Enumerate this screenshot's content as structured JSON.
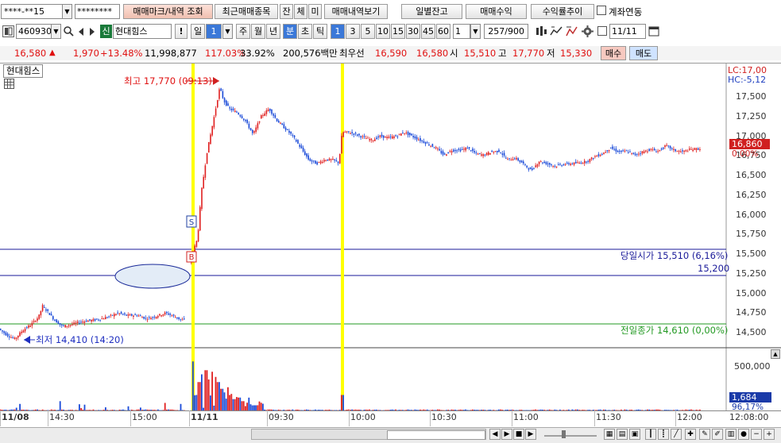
{
  "toolbar1": {
    "account": "****-**15",
    "password": "********",
    "trade_mark_button": "매매마크/내역 조회",
    "recent_trades_button": "최근매매종목",
    "tab_jan": "잔",
    "tab_che": "체",
    "tab_mi": "미",
    "trade_history_button": "매매내역보기",
    "daily_balance_button": "일별잔고",
    "trade_profit_button": "매매수익",
    "return_trend_button": "수익률추이",
    "account_link_label": "계좌연동"
  },
  "toolbar2": {
    "code": "460930",
    "credit_badge": "신",
    "stock_name": "현대힘스",
    "alert_label": "!",
    "period_day": "일",
    "period_value": "1",
    "period_week": "주",
    "period_month": "월",
    "period_year": "년",
    "period_minute": "분",
    "period_second": "초",
    "period_tick": "틱",
    "intervals": [
      "1",
      "3",
      "5",
      "10",
      "15",
      "30",
      "45",
      "60"
    ],
    "interval_input": "1",
    "count_value": "257",
    "count_total": "/900",
    "date_value": "11/11"
  },
  "quote": {
    "price": "16,580",
    "change": "1,970",
    "change_rate": "+13.48%",
    "volume": "11,998,877",
    "volume_ratio": "117.03%",
    "turnover": "33.92%",
    "amount": "200,576백만",
    "priority_label": "최우선",
    "ask": "16,590",
    "bid": "16,580",
    "open_label": "시",
    "open": "15,510",
    "high_label": "고",
    "high": "17,770",
    "low_label": "저",
    "low": "15,330",
    "buy_button": "매수",
    "sell_button": "매도"
  },
  "chart_panel": {
    "legend_name": "현대힘스",
    "lc_label": "LC:17,00",
    "hc_label": "HC:-5,12",
    "current_price": "16,860",
    "current_rate": "0.00%",
    "high_annotation": "최고 17,770 (09:13)",
    "low_annotation": "최저 14,410 (14:20)",
    "open_line_label": "당일시가 15,510 (6,16%)",
    "level_line_label": "15,200",
    "prev_close_label": "전일종가 14,610 (0,00%)",
    "sell_marker": "S",
    "buy_marker": "B",
    "volume_value": "1,684",
    "volume_ratio": "96,17%",
    "volume_axis": "500,000",
    "corner_time": "12:08:00"
  },
  "chart_data": {
    "type": "candlestick",
    "timeframe": "1분",
    "y_ticks": [
      "17,500",
      "17,250",
      "17,000",
      "16,750",
      "16,500",
      "16,250",
      "16,000",
      "15,750",
      "15,500",
      "15,250",
      "15,000",
      "14,750",
      "14,500"
    ],
    "ylim": [
      14400,
      17800
    ],
    "x_ticks": [
      "11/08",
      "14:30",
      "15:00",
      "11/11",
      "09:30",
      "10:00",
      "10:30",
      "11:00",
      "11:30",
      "12:00"
    ],
    "keypoints_day1": [
      [
        0,
        14550
      ],
      [
        10,
        14470
      ],
      [
        20,
        14420
      ],
      [
        30,
        14530
      ],
      [
        40,
        14600
      ],
      [
        50,
        14700
      ],
      [
        55,
        14840
      ],
      [
        62,
        14760
      ],
      [
        70,
        14660
      ],
      [
        80,
        14580
      ],
      [
        90,
        14600
      ],
      [
        100,
        14630
      ],
      [
        110,
        14650
      ],
      [
        120,
        14660
      ],
      [
        130,
        14680
      ],
      [
        140,
        14710
      ],
      [
        150,
        14750
      ],
      [
        160,
        14720
      ],
      [
        175,
        14720
      ],
      [
        185,
        14680
      ],
      [
        195,
        14700
      ],
      [
        210,
        14750
      ],
      [
        220,
        14710
      ],
      [
        230,
        14660
      ]
    ],
    "keypoints_day2": [
      [
        240,
        15400
      ],
      [
        245,
        15550
      ],
      [
        250,
        15700
      ],
      [
        255,
        16300
      ],
      [
        262,
        16800
      ],
      [
        270,
        17200
      ],
      [
        278,
        17620
      ],
      [
        283,
        17450
      ],
      [
        290,
        17350
      ],
      [
        300,
        17300
      ],
      [
        310,
        17200
      ],
      [
        320,
        17020
      ],
      [
        330,
        17250
      ],
      [
        340,
        17350
      ],
      [
        350,
        17200
      ],
      [
        360,
        17100
      ],
      [
        370,
        17000
      ],
      [
        380,
        16850
      ],
      [
        390,
        16700
      ],
      [
        400,
        16650
      ],
      [
        410,
        16700
      ],
      [
        420,
        16700
      ],
      [
        428,
        16660
      ],
      [
        432,
        17050
      ],
      [
        440,
        17050
      ],
      [
        450,
        17020
      ],
      [
        460,
        16980
      ],
      [
        470,
        16950
      ],
      [
        480,
        17000
      ],
      [
        490,
        16980
      ],
      [
        500,
        17000
      ],
      [
        510,
        17050
      ],
      [
        520,
        17000
      ],
      [
        530,
        16950
      ],
      [
        540,
        16900
      ],
      [
        550,
        16850
      ],
      [
        560,
        16760
      ],
      [
        570,
        16820
      ],
      [
        580,
        16820
      ],
      [
        590,
        16850
      ],
      [
        600,
        16780
      ],
      [
        610,
        16760
      ],
      [
        620,
        16800
      ],
      [
        630,
        16810
      ],
      [
        640,
        16700
      ],
      [
        650,
        16720
      ],
      [
        660,
        16650
      ],
      [
        670,
        16560
      ],
      [
        680,
        16680
      ],
      [
        690,
        16650
      ],
      [
        700,
        16620
      ],
      [
        710,
        16640
      ],
      [
        720,
        16650
      ],
      [
        730,
        16660
      ],
      [
        740,
        16680
      ],
      [
        750,
        16740
      ],
      [
        760,
        16780
      ],
      [
        770,
        16850
      ],
      [
        780,
        16800
      ],
      [
        790,
        16810
      ],
      [
        800,
        16760
      ],
      [
        810,
        16800
      ],
      [
        820,
        16830
      ],
      [
        830,
        16810
      ],
      [
        840,
        16880
      ],
      [
        850,
        16820
      ],
      [
        860,
        16800
      ],
      [
        870,
        16830
      ],
      [
        880,
        16840
      ]
    ],
    "volume_spikes": [
      [
        241,
        0.95
      ],
      [
        246,
        0.3
      ],
      [
        250,
        0.55
      ],
      [
        253,
        0.7
      ],
      [
        258,
        0.78
      ],
      [
        262,
        0.6
      ],
      [
        266,
        0.75
      ],
      [
        270,
        0.65
      ],
      [
        274,
        0.55
      ],
      [
        278,
        0.42
      ],
      [
        282,
        0.35
      ],
      [
        286,
        0.45
      ],
      [
        290,
        0.32
      ],
      [
        294,
        0.22
      ],
      [
        300,
        0.25
      ],
      [
        305,
        0.18
      ],
      [
        310,
        0.15
      ],
      [
        315,
        0.12
      ],
      [
        320,
        0.1
      ],
      [
        430,
        0.3
      ],
      [
        75,
        0.18
      ],
      [
        100,
        0.12
      ],
      [
        160,
        0.08
      ]
    ]
  }
}
